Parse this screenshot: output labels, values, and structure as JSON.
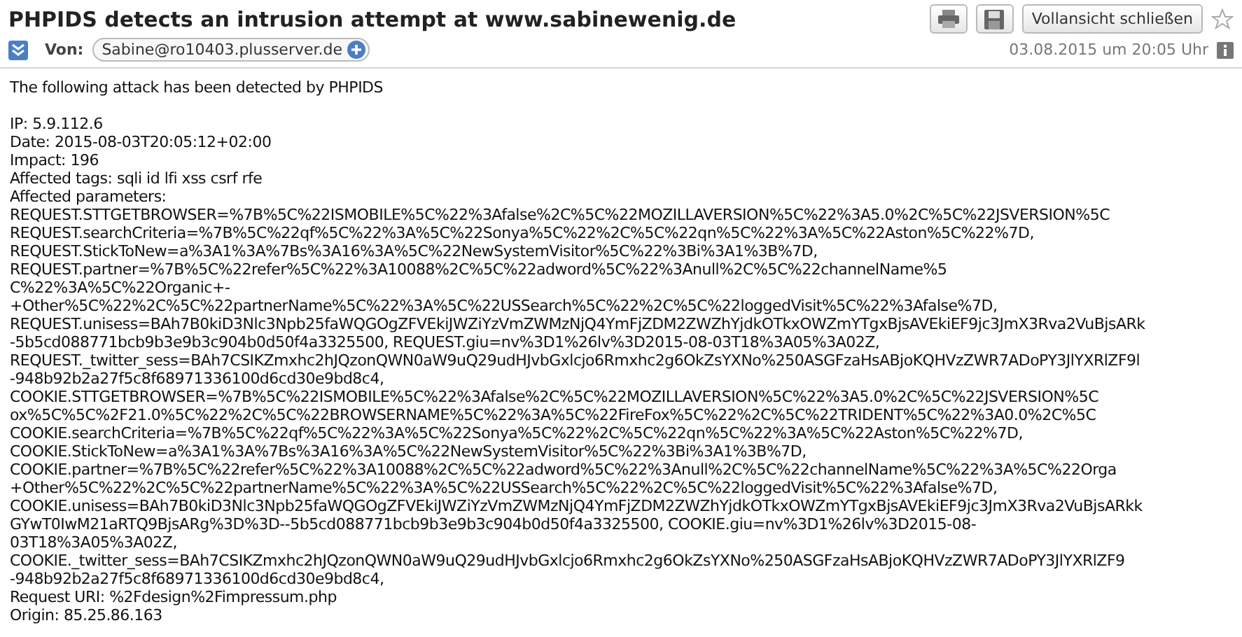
{
  "header": {
    "subject": "PHPIDS detects an intrusion attempt at www.sabinewenig.de",
    "close_button": "Vollansicht schließen",
    "from_label": "Von:",
    "sender": "Sabine@ro10403.plusserver.de",
    "date": "03.08.2015 um 20:05 Uhr",
    "starred": false
  },
  "body": {
    "intro": "The following attack has been detected by PHPIDS",
    "lines": [
      "IP: 5.9.112.6",
      "Date: 2015-08-03T20:05:12+02:00",
      "Impact: 196",
      "Affected tags: sqli id lfi xss csrf rfe",
      "Affected parameters:",
      "REQUEST.STTGETBROWSER=%7B%5C%22ISMOBILE%5C%22%3Afalse%2C%5C%22MOZILLAVERSION%5C%22%3A5.0%2C%5C%22JSVERSION%5C",
      "REQUEST.searchCriteria=%7B%5C%22qf%5C%22%3A%5C%22Sonya%5C%22%2C%5C%22qn%5C%22%3A%5C%22Aston%5C%22%7D,",
      "REQUEST.StickToNew=a%3A1%3A%7Bs%3A16%3A%5C%22NewSystemVisitor%5C%22%3Bi%3A1%3B%7D,",
      "REQUEST.partner=%7B%5C%22refer%5C%22%3A10088%2C%5C%22adword%5C%22%3Anull%2C%5C%22channelName%5",
      "C%22%3A%5C%22Organic+-",
      "+Other%5C%22%2C%5C%22partnerName%5C%22%3A%5C%22USSearch%5C%22%2C%5C%22loggedVisit%5C%22%3Afalse%7D,",
      "REQUEST.unisess=BAh7B0kiD3Nlc3Npb25faWQGOgZFVEkiJWZiYzVmZWMzNjQ4YmFjZDM2ZWZhYjdkOTkxOWZmYTgxBjsAVEkiEF9jc3JmX3Rva2VuBjsARk",
      "-5b5cd088771bcb9b3e9b3c904b0d50f4a3325500, REQUEST.giu=nv%3D1%26lv%3D2015-08-03T18%3A05%3A02Z,",
      "REQUEST._twitter_sess=BAh7CSIKZmxhc2hJQzonQWN0aW9uQ29udHJvbGxlcjo6Rmxhc2g6OkZsYXNo%250ASGFzaHsABjoKQHVzZWR7ADoPY3JlYXRlZF9l",
      "-948b92b2a27f5c8f68971336100d6cd30e9bd8c4,",
      "COOKIE.STTGETBROWSER=%7B%5C%22ISMOBILE%5C%22%3Afalse%2C%5C%22MOZILLAVERSION%5C%22%3A5.0%2C%5C%22JSVERSION%5C",
      "ox%5C%5C%2F21.0%5C%22%2C%5C%22BROWSERNAME%5C%22%3A%5C%22FireFox%5C%22%2C%5C%22TRIDENT%5C%22%3A0.0%2C%5C",
      "COOKIE.searchCriteria=%7B%5C%22qf%5C%22%3A%5C%22Sonya%5C%22%2C%5C%22qn%5C%22%3A%5C%22Aston%5C%22%7D,",
      "COOKIE.StickToNew=a%3A1%3A%7Bs%3A16%3A%5C%22NewSystemVisitor%5C%22%3Bi%3A1%3B%7D,",
      "COOKIE.partner=%7B%5C%22refer%5C%22%3A10088%2C%5C%22adword%5C%22%3Anull%2C%5C%22channelName%5C%22%3A%5C%22Orga",
      "+Other%5C%22%2C%5C%22partnerName%5C%22%3A%5C%22USSearch%5C%22%2C%5C%22loggedVisit%5C%22%3Afalse%7D,",
      "COOKIE.unisess=BAh7B0kiD3Nlc3Npb25faWQGOgZFVEkiJWZiYzVmZWMzNjQ4YmFjZDM2ZWZhYjdkOTkxOWZmYTgxBjsAVEkiEF9jc3JmX3Rva2VuBjsARkk",
      "GYwT0IwM21aRTQ9BjsARg%3D%3D--5b5cd088771bcb9b3e9b3c904b0d50f4a3325500, COOKIE.giu=nv%3D1%26lv%3D2015-08-",
      "03T18%3A05%3A02Z,",
      "COOKIE._twitter_sess=BAh7CSIKZmxhc2hJQzonQWN0aW9uQ29udHJvbGxlcjo6Rmxhc2g6OkZsYXNo%250ASGFzaHsABjoKQHVzZWR7ADoPY3JlYXRlZF9",
      "-948b92b2a27f5c8f68971336100d6cd30e9bd8c4,",
      "Request URI: %2Fdesign%2Fimpressum.php",
      "Origin: 85.25.86.163"
    ]
  }
}
